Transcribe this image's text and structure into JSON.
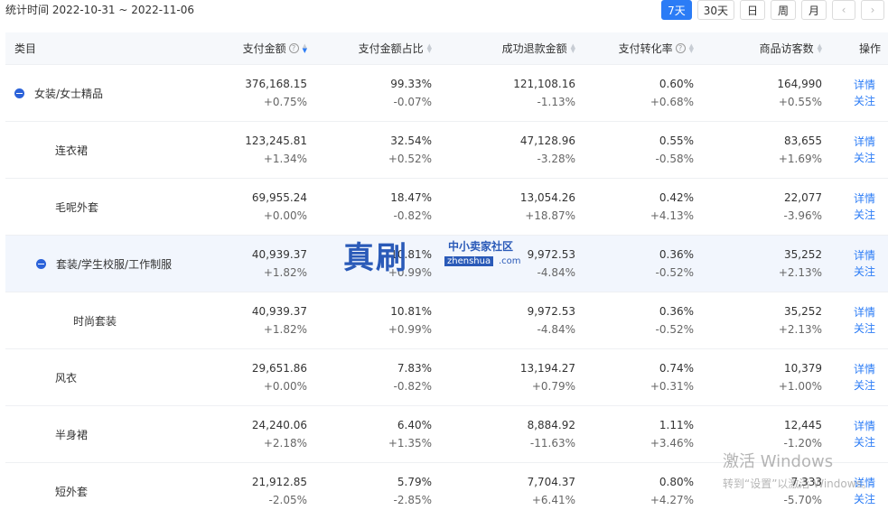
{
  "date_range": "统计时间 2022-10-31 ~ 2022-11-06",
  "range_buttons": [
    {
      "label": "7天",
      "active": true
    },
    {
      "label": "30天",
      "active": false
    },
    {
      "label": "日",
      "active": false
    },
    {
      "label": "周",
      "active": false
    },
    {
      "label": "月",
      "active": false
    }
  ],
  "nav": {
    "prev": "‹",
    "next": "›"
  },
  "headers": {
    "category": "类目",
    "pay_amount": "支付金额",
    "pay_share": "支付金额占比",
    "refund": "成功退款金额",
    "conversion": "支付转化率",
    "visitors": "商品访客数",
    "ops": "操作"
  },
  "help_glyph": "?",
  "sort_glyphs": {
    "up": "▲",
    "down": "▼"
  },
  "ops": {
    "detail": "详情",
    "follow": "关注"
  },
  "rows": [
    {
      "name": "女装/女士精品",
      "pay": "376,168.15",
      "pay_d": "+0.75%",
      "pct": "99.33%",
      "pct_d": "-0.07%",
      "ref": "121,108.16",
      "ref_d": "-1.13%",
      "cvr": "0.60%",
      "cvr_d": "+0.68%",
      "vis": "164,990",
      "vis_d": "+0.55%"
    },
    {
      "name": "连衣裙",
      "pay": "123,245.81",
      "pay_d": "+1.34%",
      "pct": "32.54%",
      "pct_d": "+0.52%",
      "ref": "47,128.96",
      "ref_d": "-3.28%",
      "cvr": "0.55%",
      "cvr_d": "-0.58%",
      "vis": "83,655",
      "vis_d": "+1.69%"
    },
    {
      "name": "毛呢外套",
      "pay": "69,955.24",
      "pay_d": "+0.00%",
      "pct": "18.47%",
      "pct_d": "-0.82%",
      "ref": "13,054.26",
      "ref_d": "+18.87%",
      "cvr": "0.42%",
      "cvr_d": "+4.13%",
      "vis": "22,077",
      "vis_d": "-3.96%"
    },
    {
      "name": "套装/学生校服/工作制服",
      "pay": "40,939.37",
      "pay_d": "+1.82%",
      "pct": "10.81%",
      "pct_d": "+0.99%",
      "ref": "9,972.53",
      "ref_d": "-4.84%",
      "cvr": "0.36%",
      "cvr_d": "-0.52%",
      "vis": "35,252",
      "vis_d": "+2.13%"
    },
    {
      "name": "时尚套装",
      "pay": "40,939.37",
      "pay_d": "+1.82%",
      "pct": "10.81%",
      "pct_d": "+0.99%",
      "ref": "9,972.53",
      "ref_d": "-4.84%",
      "cvr": "0.36%",
      "cvr_d": "-0.52%",
      "vis": "35,252",
      "vis_d": "+2.13%"
    },
    {
      "name": "风衣",
      "pay": "29,651.86",
      "pay_d": "+0.00%",
      "pct": "7.83%",
      "pct_d": "-0.82%",
      "ref": "13,194.27",
      "ref_d": "+0.79%",
      "cvr": "0.74%",
      "cvr_d": "+0.31%",
      "vis": "10,379",
      "vis_d": "+1.00%"
    },
    {
      "name": "半身裙",
      "pay": "24,240.06",
      "pay_d": "+2.18%",
      "pct": "6.40%",
      "pct_d": "+1.35%",
      "ref": "8,884.92",
      "ref_d": "-11.63%",
      "cvr": "1.11%",
      "cvr_d": "+3.46%",
      "vis": "12,445",
      "vis_d": "-1.20%"
    },
    {
      "name": "短外套",
      "pay": "21,912.85",
      "pay_d": "-2.05%",
      "pct": "5.79%",
      "pct_d": "-2.85%",
      "ref": "7,704.37",
      "ref_d": "+6.41%",
      "cvr": "0.80%",
      "cvr_d": "+4.27%",
      "vis": "7,333",
      "vis_d": "-5.70%"
    }
  ],
  "watermark": {
    "big": "真刷",
    "small": "中小卖家社区",
    "url": "zhenshua",
    "com": ".com"
  },
  "activation": {
    "title": "激活 Windows",
    "subtitle": "转到“设置”以激活 Windows。"
  }
}
